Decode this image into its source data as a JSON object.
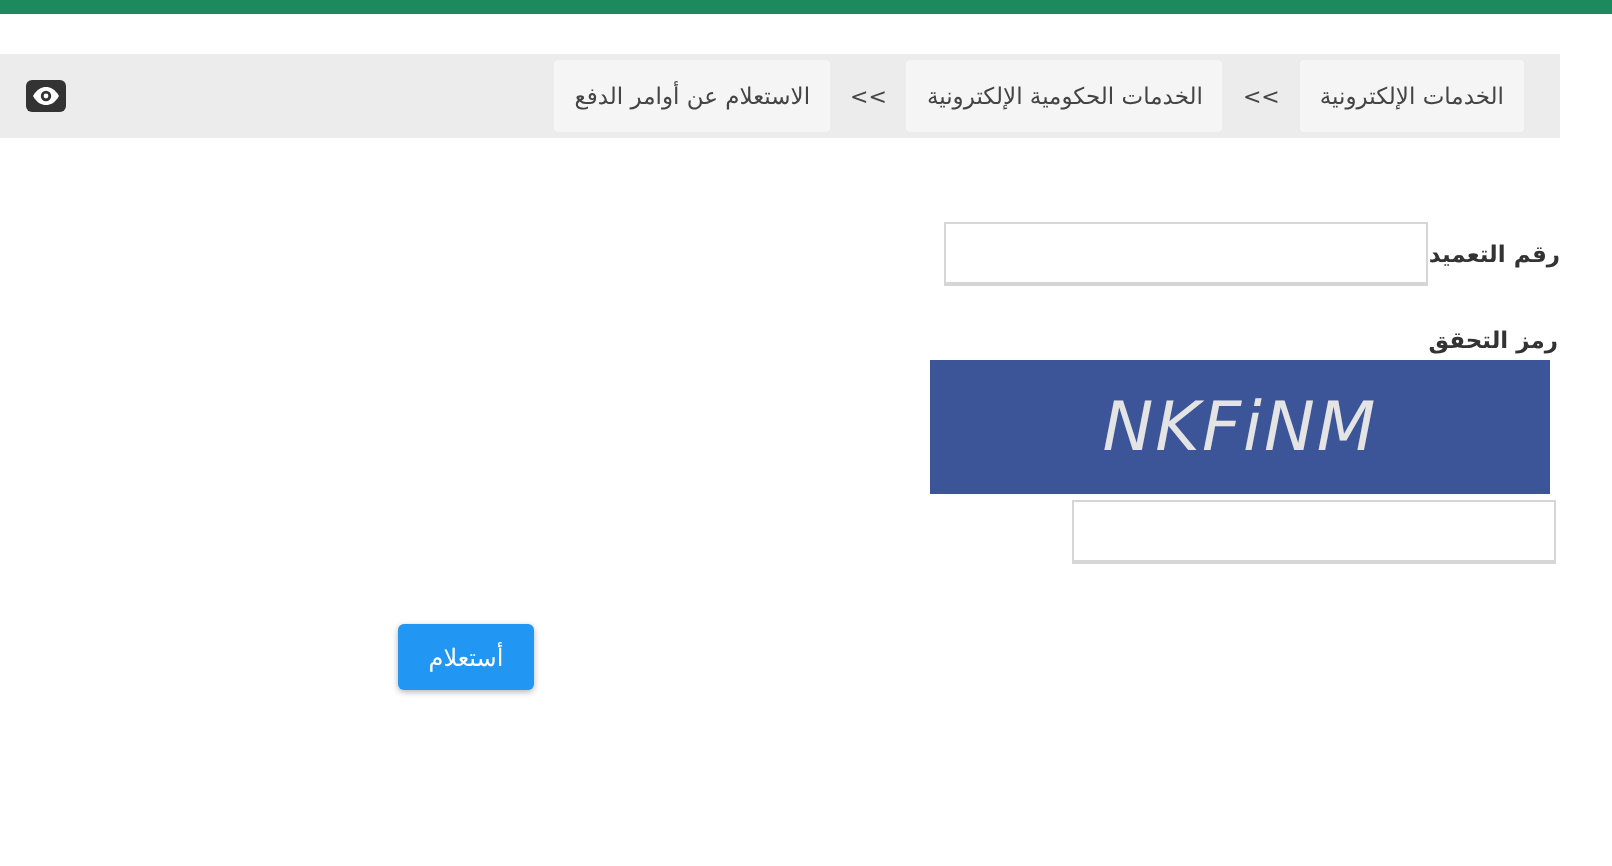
{
  "breadcrumb": {
    "items": [
      {
        "label": "الخدمات الإلكترونية"
      },
      {
        "label": "الخدمات الحكومية الإلكترونية"
      },
      {
        "label": "الاستعلام عن أوامر الدفع"
      }
    ],
    "separator": ">>"
  },
  "form": {
    "fields": [
      {
        "label": "رقم التعميد",
        "kind": "text"
      },
      {
        "label": "رمز التحقق",
        "kind": "captcha",
        "captcha_text": "NKFiNM"
      }
    ],
    "submit": "أستعلام"
  }
}
